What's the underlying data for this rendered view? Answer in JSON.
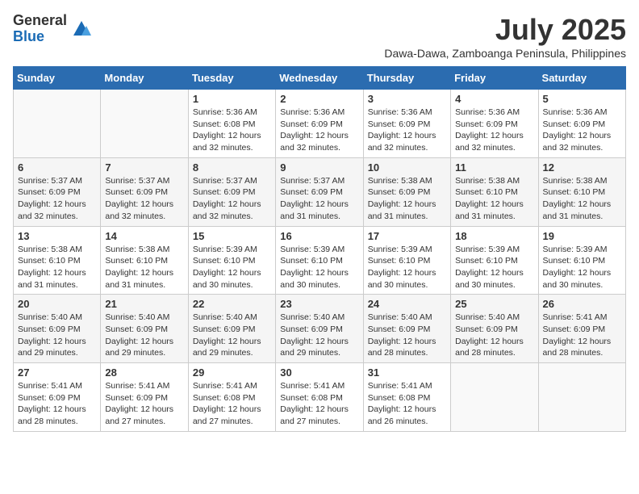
{
  "logo": {
    "general": "General",
    "blue": "Blue"
  },
  "title": "July 2025",
  "location": "Dawa-Dawa, Zamboanga Peninsula, Philippines",
  "days_of_week": [
    "Sunday",
    "Monday",
    "Tuesday",
    "Wednesday",
    "Thursday",
    "Friday",
    "Saturday"
  ],
  "weeks": [
    [
      {
        "day": "",
        "info": ""
      },
      {
        "day": "",
        "info": ""
      },
      {
        "day": "1",
        "info": "Sunrise: 5:36 AM\nSunset: 6:08 PM\nDaylight: 12 hours and 32 minutes."
      },
      {
        "day": "2",
        "info": "Sunrise: 5:36 AM\nSunset: 6:09 PM\nDaylight: 12 hours and 32 minutes."
      },
      {
        "day": "3",
        "info": "Sunrise: 5:36 AM\nSunset: 6:09 PM\nDaylight: 12 hours and 32 minutes."
      },
      {
        "day": "4",
        "info": "Sunrise: 5:36 AM\nSunset: 6:09 PM\nDaylight: 12 hours and 32 minutes."
      },
      {
        "day": "5",
        "info": "Sunrise: 5:36 AM\nSunset: 6:09 PM\nDaylight: 12 hours and 32 minutes."
      }
    ],
    [
      {
        "day": "6",
        "info": "Sunrise: 5:37 AM\nSunset: 6:09 PM\nDaylight: 12 hours and 32 minutes."
      },
      {
        "day": "7",
        "info": "Sunrise: 5:37 AM\nSunset: 6:09 PM\nDaylight: 12 hours and 32 minutes."
      },
      {
        "day": "8",
        "info": "Sunrise: 5:37 AM\nSunset: 6:09 PM\nDaylight: 12 hours and 32 minutes."
      },
      {
        "day": "9",
        "info": "Sunrise: 5:37 AM\nSunset: 6:09 PM\nDaylight: 12 hours and 31 minutes."
      },
      {
        "day": "10",
        "info": "Sunrise: 5:38 AM\nSunset: 6:09 PM\nDaylight: 12 hours and 31 minutes."
      },
      {
        "day": "11",
        "info": "Sunrise: 5:38 AM\nSunset: 6:10 PM\nDaylight: 12 hours and 31 minutes."
      },
      {
        "day": "12",
        "info": "Sunrise: 5:38 AM\nSunset: 6:10 PM\nDaylight: 12 hours and 31 minutes."
      }
    ],
    [
      {
        "day": "13",
        "info": "Sunrise: 5:38 AM\nSunset: 6:10 PM\nDaylight: 12 hours and 31 minutes."
      },
      {
        "day": "14",
        "info": "Sunrise: 5:38 AM\nSunset: 6:10 PM\nDaylight: 12 hours and 31 minutes."
      },
      {
        "day": "15",
        "info": "Sunrise: 5:39 AM\nSunset: 6:10 PM\nDaylight: 12 hours and 30 minutes."
      },
      {
        "day": "16",
        "info": "Sunrise: 5:39 AM\nSunset: 6:10 PM\nDaylight: 12 hours and 30 minutes."
      },
      {
        "day": "17",
        "info": "Sunrise: 5:39 AM\nSunset: 6:10 PM\nDaylight: 12 hours and 30 minutes."
      },
      {
        "day": "18",
        "info": "Sunrise: 5:39 AM\nSunset: 6:10 PM\nDaylight: 12 hours and 30 minutes."
      },
      {
        "day": "19",
        "info": "Sunrise: 5:39 AM\nSunset: 6:10 PM\nDaylight: 12 hours and 30 minutes."
      }
    ],
    [
      {
        "day": "20",
        "info": "Sunrise: 5:40 AM\nSunset: 6:09 PM\nDaylight: 12 hours and 29 minutes."
      },
      {
        "day": "21",
        "info": "Sunrise: 5:40 AM\nSunset: 6:09 PM\nDaylight: 12 hours and 29 minutes."
      },
      {
        "day": "22",
        "info": "Sunrise: 5:40 AM\nSunset: 6:09 PM\nDaylight: 12 hours and 29 minutes."
      },
      {
        "day": "23",
        "info": "Sunrise: 5:40 AM\nSunset: 6:09 PM\nDaylight: 12 hours and 29 minutes."
      },
      {
        "day": "24",
        "info": "Sunrise: 5:40 AM\nSunset: 6:09 PM\nDaylight: 12 hours and 28 minutes."
      },
      {
        "day": "25",
        "info": "Sunrise: 5:40 AM\nSunset: 6:09 PM\nDaylight: 12 hours and 28 minutes."
      },
      {
        "day": "26",
        "info": "Sunrise: 5:41 AM\nSunset: 6:09 PM\nDaylight: 12 hours and 28 minutes."
      }
    ],
    [
      {
        "day": "27",
        "info": "Sunrise: 5:41 AM\nSunset: 6:09 PM\nDaylight: 12 hours and 28 minutes."
      },
      {
        "day": "28",
        "info": "Sunrise: 5:41 AM\nSunset: 6:09 PM\nDaylight: 12 hours and 27 minutes."
      },
      {
        "day": "29",
        "info": "Sunrise: 5:41 AM\nSunset: 6:08 PM\nDaylight: 12 hours and 27 minutes."
      },
      {
        "day": "30",
        "info": "Sunrise: 5:41 AM\nSunset: 6:08 PM\nDaylight: 12 hours and 27 minutes."
      },
      {
        "day": "31",
        "info": "Sunrise: 5:41 AM\nSunset: 6:08 PM\nDaylight: 12 hours and 26 minutes."
      },
      {
        "day": "",
        "info": ""
      },
      {
        "day": "",
        "info": ""
      }
    ]
  ]
}
